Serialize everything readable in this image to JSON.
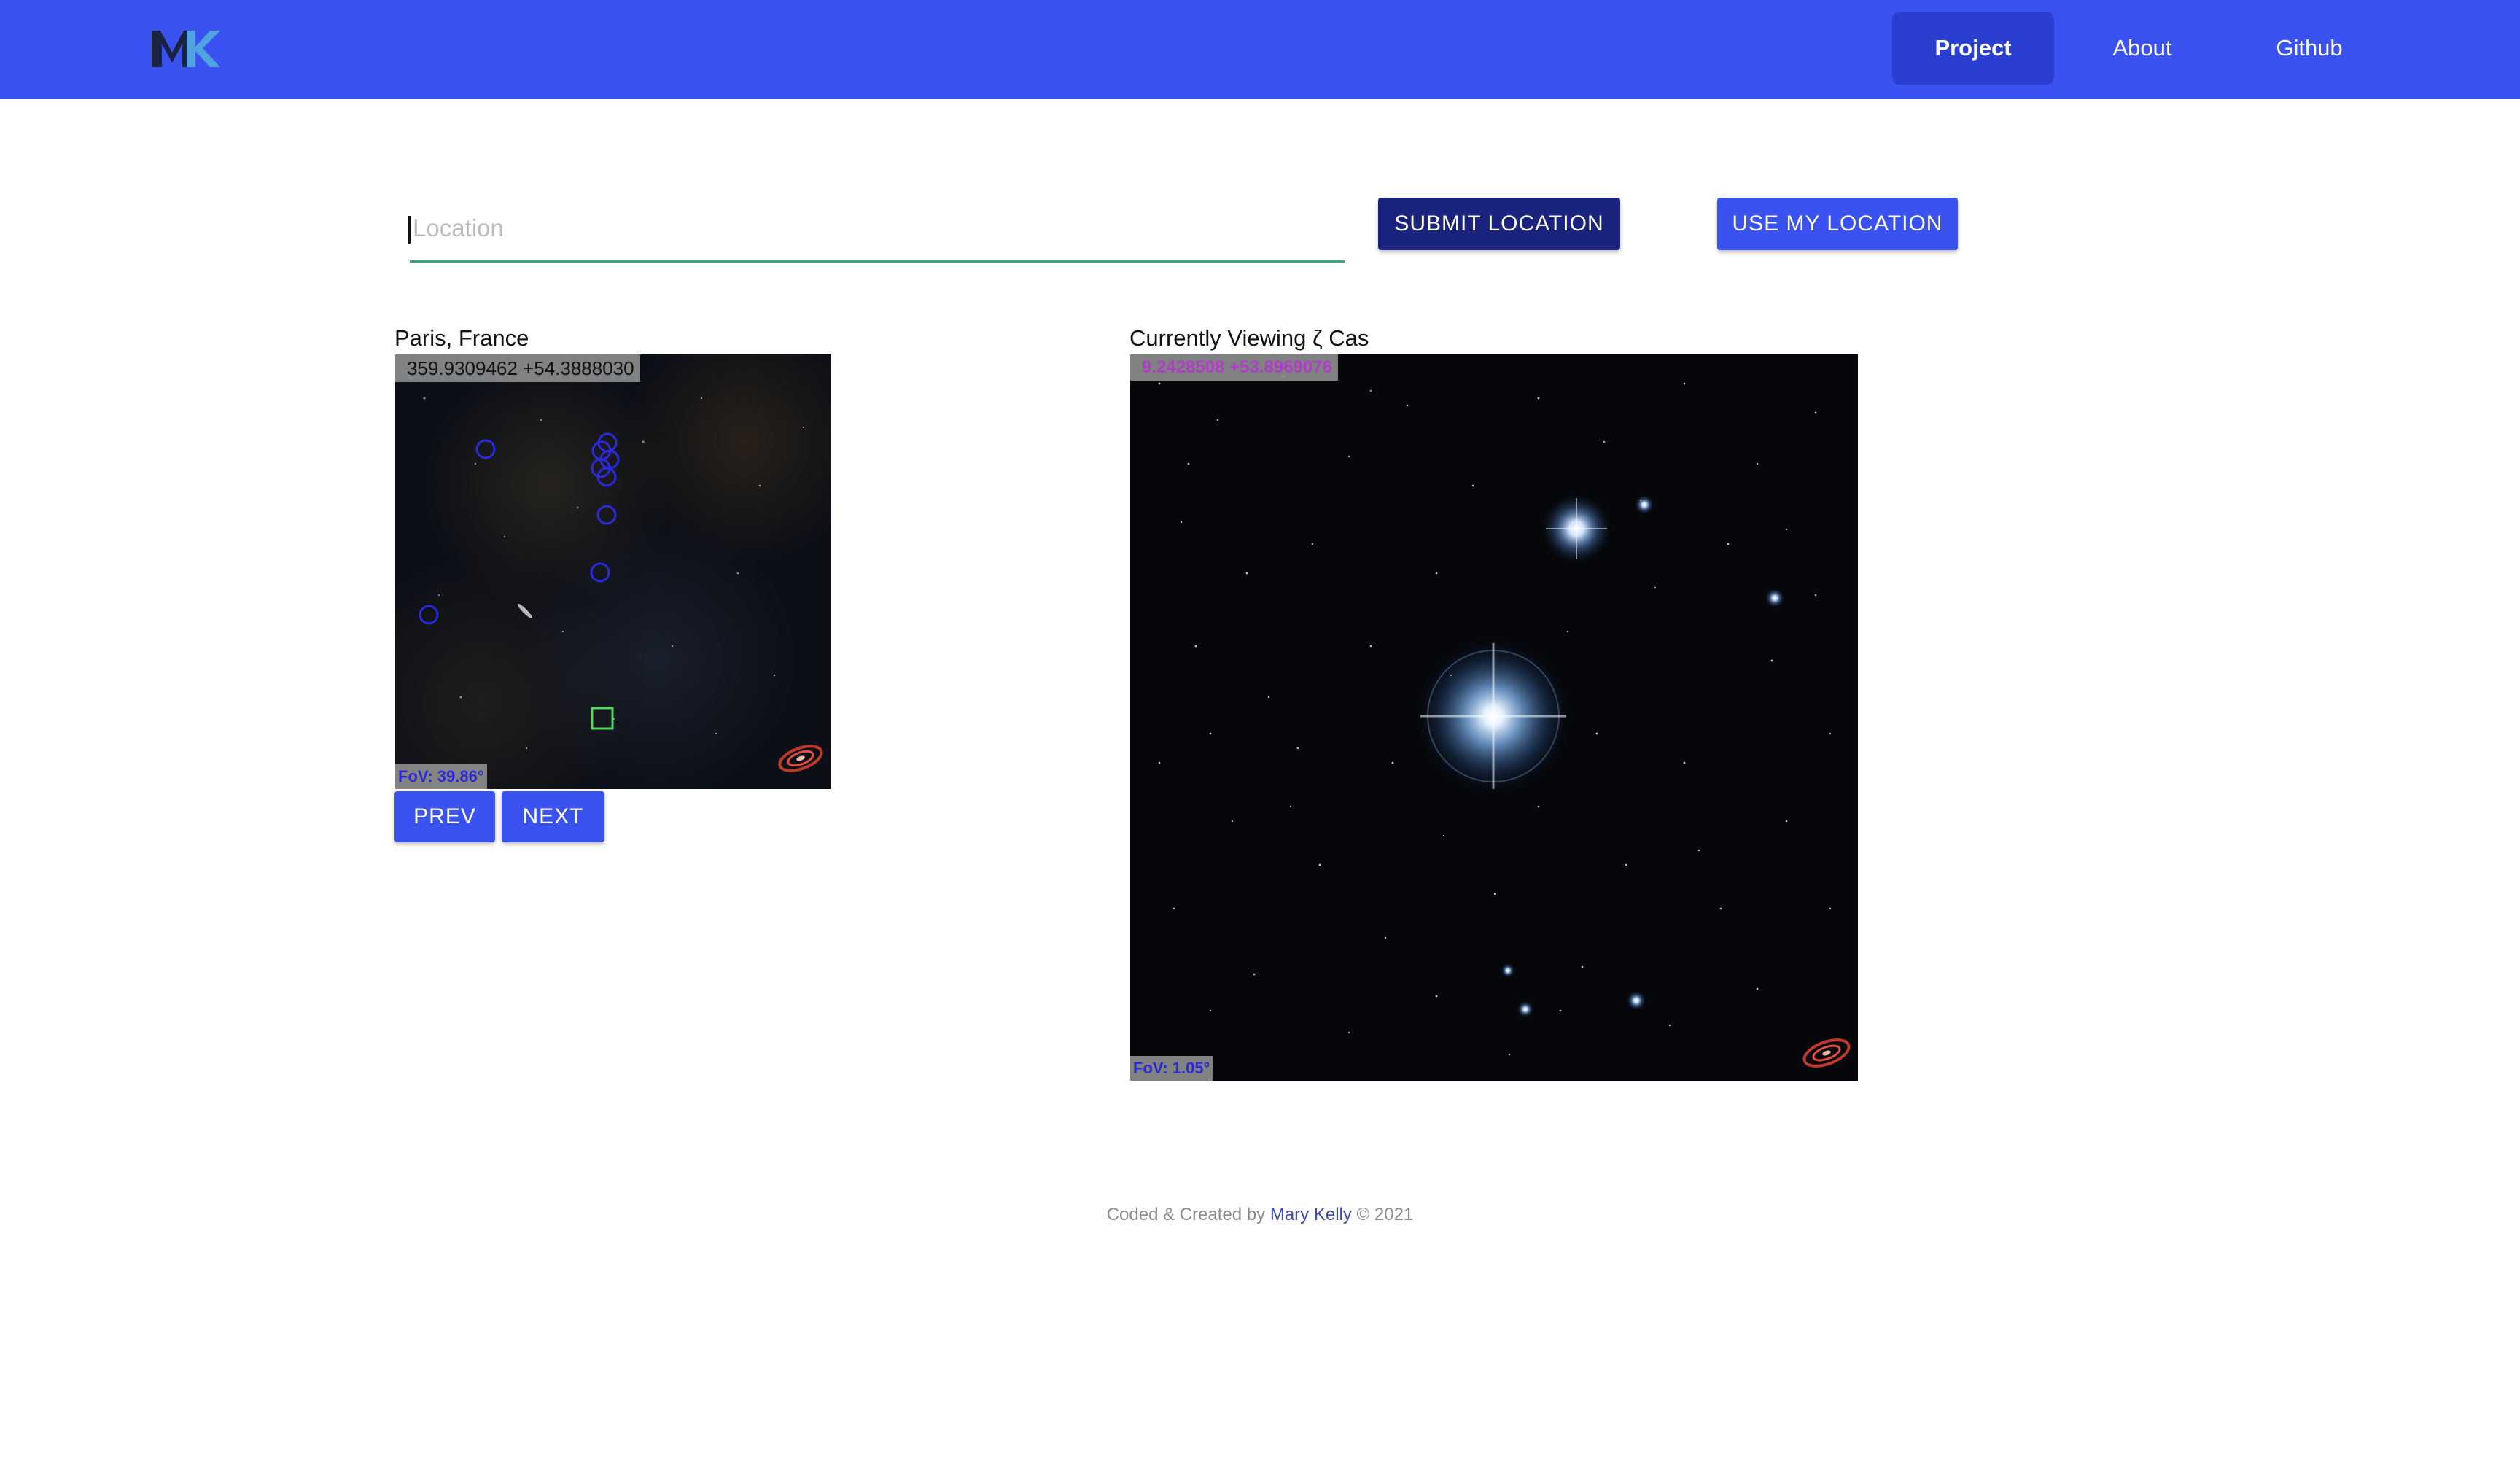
{
  "header": {
    "logo_text": "MK",
    "nav": [
      {
        "label": "Project",
        "active": true
      },
      {
        "label": "About"
      },
      {
        "label": "Github"
      }
    ],
    "accent_color": "#3a52f0"
  },
  "search": {
    "placeholder": "Location",
    "value": "",
    "submit_label": "SUBMIT LOCATION",
    "use_location_label": "USE MY LOCATION"
  },
  "left_panel": {
    "place": "Paris, France",
    "coordinates": "359.9309462 +54.3888030",
    "fov": "FoV: 39.86°",
    "prev_label": "PREV",
    "next_label": "NEXT"
  },
  "right_panel": {
    "heading": "Currently Viewing ζ Cas",
    "coordinates": "9.2428508 +53.8969076",
    "fov": "FoV: 1.05°"
  },
  "footer": {
    "prefix": "Coded & Created by ",
    "author": "Mary Kelly",
    "suffix": " © 2021"
  }
}
